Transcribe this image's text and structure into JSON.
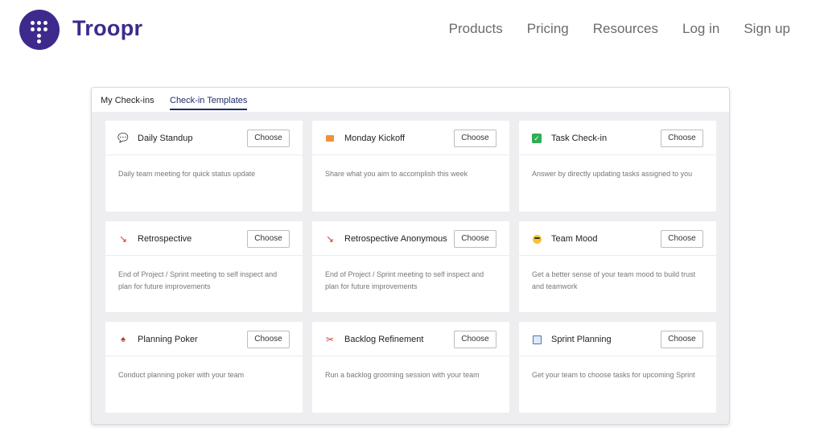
{
  "brand": {
    "name": "Troopr",
    "accent": "#3e2a8c"
  },
  "nav": {
    "items": [
      "Products",
      "Pricing",
      "Resources",
      "Log in",
      "Sign up"
    ]
  },
  "tabs": [
    "My Check-ins",
    "Check-in Templates"
  ],
  "active_tab": "Check-in Templates",
  "cards": [
    {
      "title": "Daily Standup",
      "button": "Choose",
      "icon": "speech-bubble-icon",
      "description": "Daily team meeting for quick status update"
    },
    {
      "title": "Monday Kickoff",
      "button": "Choose",
      "icon": "kickoff-icon",
      "description": "Share what you aim to accomplish this week"
    },
    {
      "title": "Task Check-in",
      "button": "Choose",
      "icon": "checkmark-icon",
      "description": "Answer by directly updating tasks assigned to you"
    },
    {
      "title": "Retrospective",
      "button": "Choose",
      "icon": "arrow-icon",
      "description": "End of Project / Sprint meeting to self inspect and plan for future improvements"
    },
    {
      "title": "Retrospective Anonymous",
      "button": "Choose",
      "icon": "arrow-icon",
      "description": "End of Project / Sprint meeting to self inspect and plan for future improvements"
    },
    {
      "title": "Team Mood",
      "button": "Choose",
      "icon": "sunglasses-face-icon",
      "description": "Get a better sense of your team mood to build trust and teamwork"
    },
    {
      "title": "Planning Poker",
      "button": "Choose",
      "icon": "poker-card-icon",
      "description": "Conduct planning poker with your team"
    },
    {
      "title": "Backlog Refinement",
      "button": "Choose",
      "icon": "scissors-icon",
      "description": "Run a backlog grooming session with your team"
    },
    {
      "title": "Sprint Planning",
      "button": "Choose",
      "icon": "calendar-board-icon",
      "description": "Get your team to choose tasks for upcoming Sprint"
    }
  ]
}
